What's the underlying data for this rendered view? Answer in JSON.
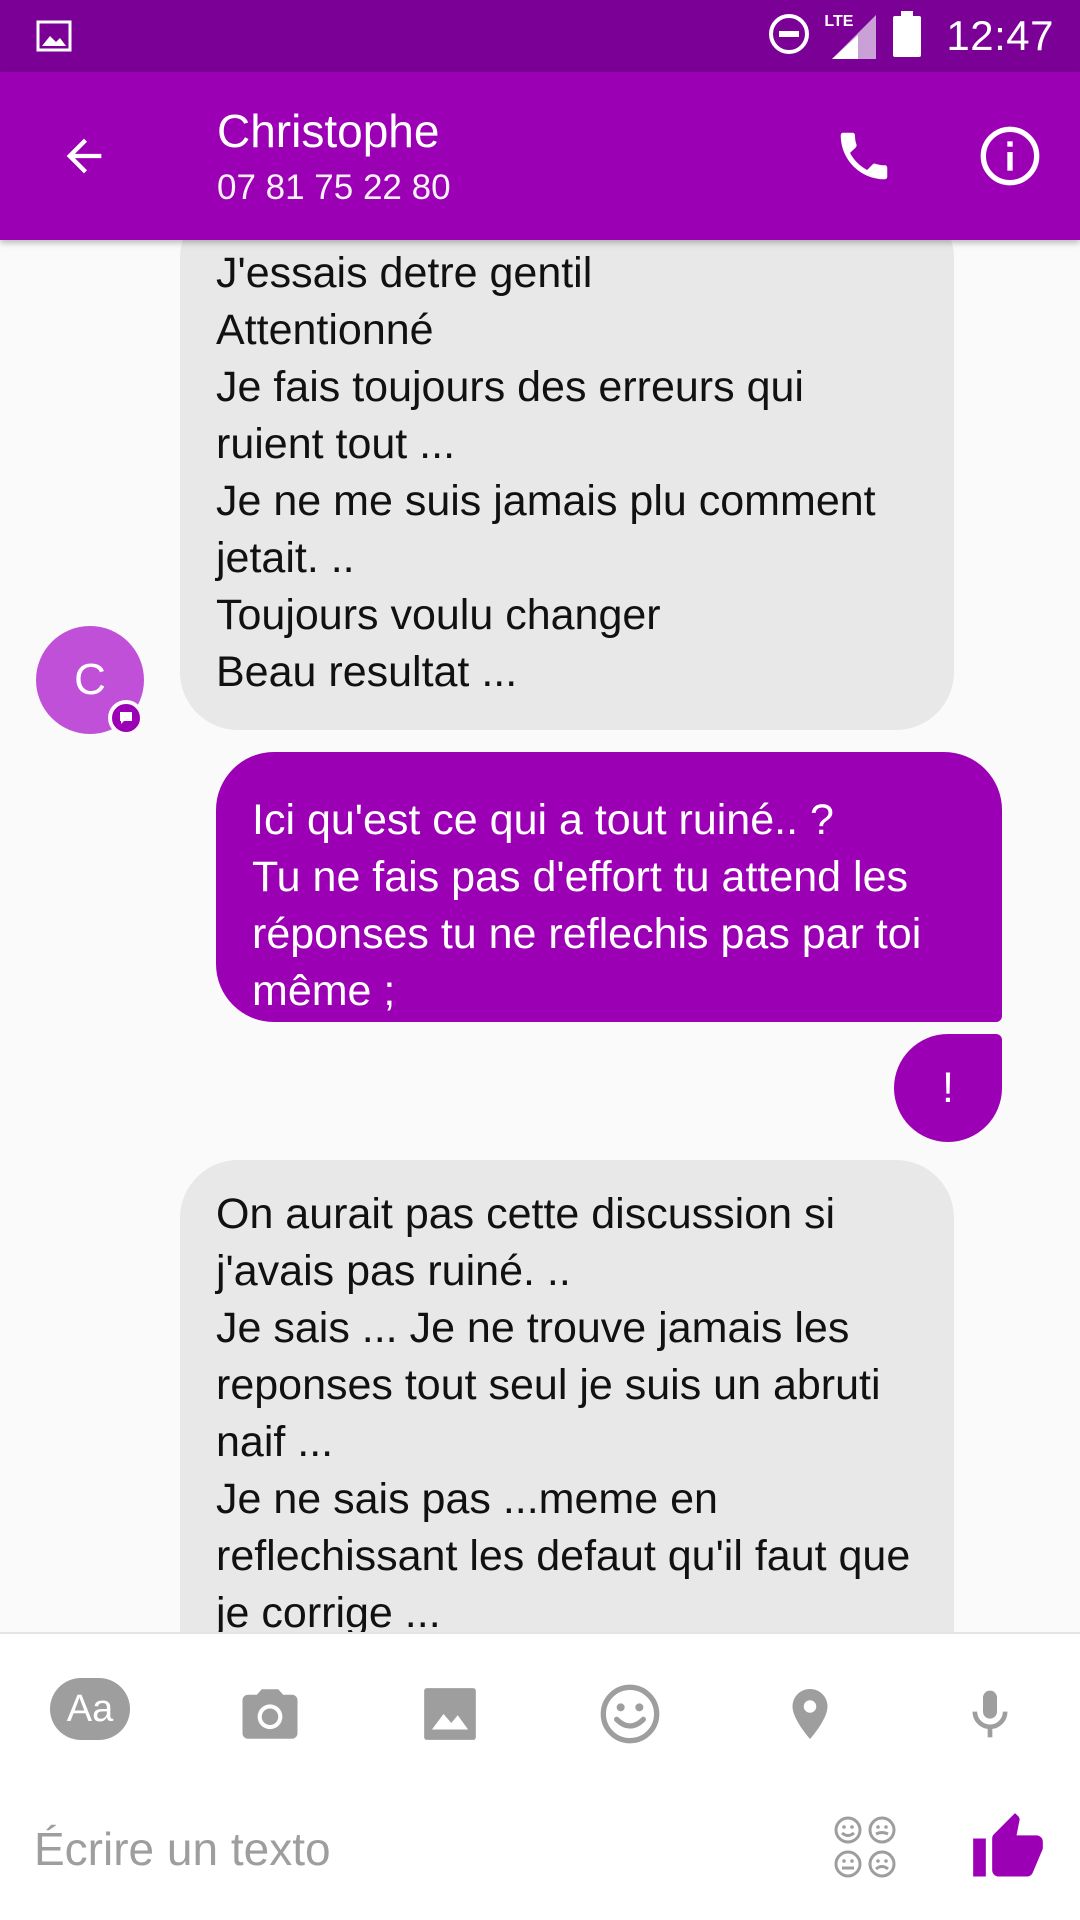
{
  "status_bar": {
    "time": "12:47",
    "network": "LTE"
  },
  "header": {
    "contact_name": "Christophe",
    "contact_phone": "07 81 75 22 80"
  },
  "avatar": {
    "initial": "C"
  },
  "messages": [
    {
      "direction": "incoming",
      "text": "J'essais detre gentil\nAttentionné\nJe fais toujours des erreurs qui ruient tout ...\nJe ne me suis jamais plu comment jetait. ..\nToujours voulu changer\nBeau resultat ..."
    },
    {
      "direction": "outgoing",
      "text": "Ici qu'est ce qui a tout ruiné.. ?\nTu ne fais pas d'effort tu attend les réponses tu ne reflechis pas par toi même ;"
    },
    {
      "direction": "outgoing",
      "text": "!"
    },
    {
      "direction": "incoming",
      "text": "On aurait pas cette discussion si j'avais pas ruiné. ..\nJe sais ... Je ne trouve jamais les reponses tout seul je suis un abruti naif ...\nJe ne sais pas ...meme en reflechissant les defaut qu'il faut que je corrige ..."
    }
  ],
  "composer": {
    "aa_label": "Aa",
    "placeholder": "Écrire un texto"
  },
  "colors": {
    "status_bar": "#7b0096",
    "accent": "#9c00b5",
    "incoming_bubble": "#e8e8e8",
    "avatar": "#c150d8",
    "tool_icon": "#9e9e9e"
  }
}
